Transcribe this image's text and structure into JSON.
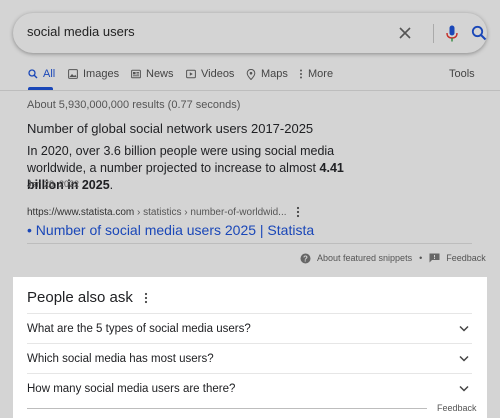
{
  "search": {
    "query": "social media users"
  },
  "tabs": [
    {
      "label": "All",
      "icon": "search-icon"
    },
    {
      "label": "Images",
      "icon": "image-icon"
    },
    {
      "label": "News",
      "icon": "news-icon"
    },
    {
      "label": "Videos",
      "icon": "video-icon"
    },
    {
      "label": "Maps",
      "icon": "map-pin-icon"
    },
    {
      "label": "More",
      "icon": "more-dots-icon"
    }
  ],
  "tools_label": "Tools",
  "results_stats": "About 5,930,000,000 results (0.77 seconds)",
  "snippet": {
    "heading": "Number of global social network users 2017-2025",
    "body_prefix": "In 2020, over 3.6 billion people were using social media worldwide, a number projected to increase to almost ",
    "body_bold": "4.41 billion in 2025",
    "body_suffix": ".",
    "date": "Jan 28, 2022"
  },
  "result": {
    "url_domain": "https://www.statista.com",
    "url_crumbs": " › statistics › number-of-worldwid...",
    "title": "• Number of social media users 2025 | Statista"
  },
  "about_snippets_label": "About featured snippets",
  "separator": "•",
  "feedback_label": "Feedback",
  "people_also_ask": {
    "title": "People also ask",
    "questions": [
      "What are the 5 types of social media users?",
      "Which social media has most users?",
      "How many social media users are there?"
    ],
    "feedback_label": "Feedback"
  },
  "colors": {
    "link": "#1a47b8",
    "mic_blue": "#1a47b8",
    "mic_red": "#c5302a",
    "background": "#d4d4d4",
    "card": "#ffffff"
  }
}
